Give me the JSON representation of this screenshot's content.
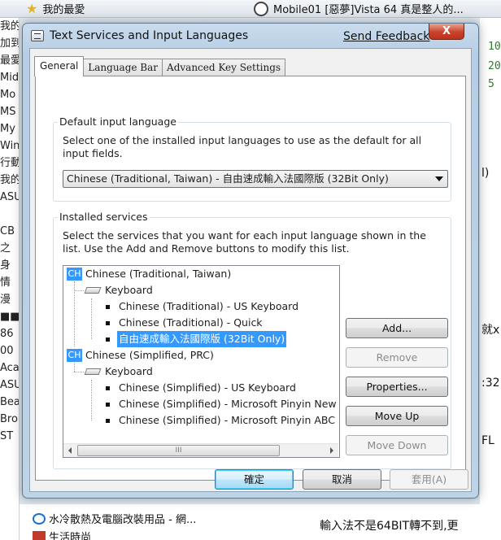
{
  "background": {
    "favorites_label": "我的最愛",
    "tab_title": "Mobile01 [惡夢]Vista 64 真是整人的...",
    "left_fragments": [
      "我的",
      "加到",
      "最愛",
      "Mid",
      "Mo",
      "MS",
      "My",
      "Win",
      "行動",
      "我的",
      "ASU",
      "",
      "CB",
      "之",
      "身",
      "情",
      "漫",
      "■■",
      "86",
      "00",
      "Aca",
      "ASU",
      "Bea",
      "Bro",
      "ST"
    ],
    "right_numbers": [
      "10",
      "20",
      "5"
    ],
    "right_fragments": [
      "l)",
      "就x",
      ":32",
      "FL"
    ],
    "bottom_item1": "水冷散熱及電腦改裝用品 - 網...",
    "bottom_item2": "生活時尚",
    "bottom_post_text": "輸入法不是64BIT轉不到,更"
  },
  "dialog": {
    "title": "Text Services and Input Languages",
    "send_feedback": "Send Feedback",
    "close_symbol": "X",
    "tabs": [
      {
        "label": "General",
        "active": true
      },
      {
        "label": "Language Bar",
        "active": false
      },
      {
        "label": "Advanced Key Settings",
        "active": false
      }
    ],
    "default_language": {
      "group_title": "Default input language",
      "description": "Select one of the installed input languages to use as the default for all input fields.",
      "selected_value": "Chinese (Traditional, Taiwan) - 自由速成輸入法國際版 (32Bit Only)"
    },
    "installed_services": {
      "group_title": "Installed services",
      "description": "Select the services that you want for each input language shown in the list. Use the Add and Remove buttons to modify this list.",
      "tree": [
        {
          "badge": "CH",
          "language": "Chinese (Traditional, Taiwan)",
          "category": "Keyboard",
          "services": [
            "Chinese (Traditional) - US Keyboard",
            "Chinese (Traditional) - Quick",
            "自由速成輸入法國際版 (32Bit Only)"
          ],
          "selected_service": "自由速成輸入法國際版 (32Bit Only)"
        },
        {
          "badge": "CH",
          "language": "Chinese (Simplified, PRC)",
          "category": "Keyboard",
          "services": [
            "Chinese (Simplified) - US Keyboard",
            "Chinese (Simplified) - Microsoft Pinyin New E",
            "Chinese (Simplified) - Microsoft Pinyin ABC In"
          ]
        }
      ],
      "scroll_thumb_grip": "III",
      "buttons": {
        "add": "Add...",
        "remove": "Remove",
        "properties": "Properties...",
        "move_up": "Move Up",
        "move_down": "Move Down"
      },
      "disabled_buttons": [
        "remove",
        "move_down"
      ]
    },
    "footer": {
      "ok": "確定",
      "cancel": "取消",
      "apply": "套用(A)",
      "apply_disabled": true
    }
  },
  "colors": {
    "selection": "#3399ff",
    "close_button": "#c8432c",
    "window_frame": "#bfd3e7"
  }
}
